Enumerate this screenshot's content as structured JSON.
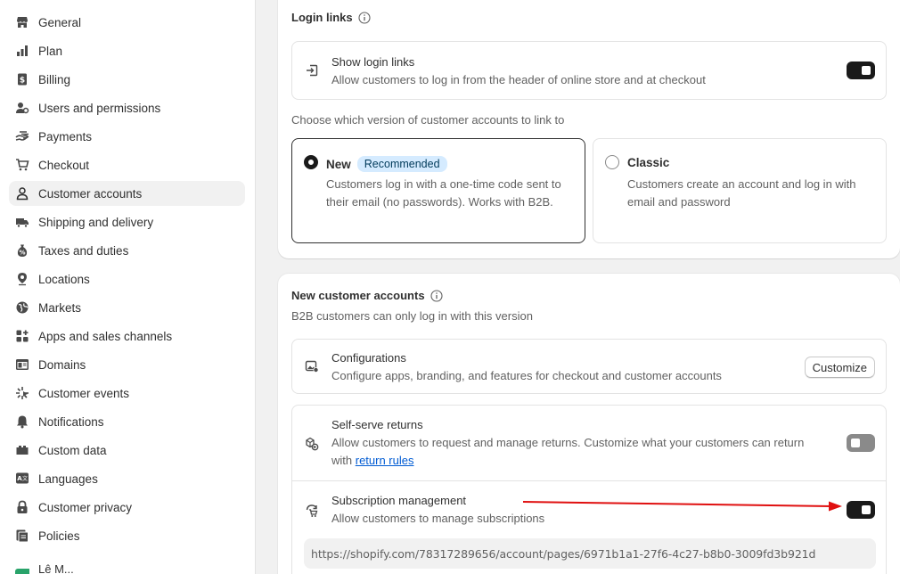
{
  "sidebar": {
    "items": [
      {
        "label": "General",
        "icon": "store-icon"
      },
      {
        "label": "Plan",
        "icon": "plan-icon"
      },
      {
        "label": "Billing",
        "icon": "billing-icon"
      },
      {
        "label": "Users and permissions",
        "icon": "users-icon"
      },
      {
        "label": "Payments",
        "icon": "payments-icon"
      },
      {
        "label": "Checkout",
        "icon": "cart-icon"
      },
      {
        "label": "Customer accounts",
        "icon": "person-icon",
        "active": true
      },
      {
        "label": "Shipping and delivery",
        "icon": "truck-icon"
      },
      {
        "label": "Taxes and duties",
        "icon": "tax-icon"
      },
      {
        "label": "Locations",
        "icon": "location-icon"
      },
      {
        "label": "Markets",
        "icon": "globe-icon"
      },
      {
        "label": "Apps and sales channels",
        "icon": "apps-icon"
      },
      {
        "label": "Domains",
        "icon": "domain-icon"
      },
      {
        "label": "Customer events",
        "icon": "events-icon"
      },
      {
        "label": "Notifications",
        "icon": "bell-icon"
      },
      {
        "label": "Custom data",
        "icon": "custom-data-icon"
      },
      {
        "label": "Languages",
        "icon": "language-icon"
      },
      {
        "label": "Customer privacy",
        "icon": "lock-icon"
      },
      {
        "label": "Policies",
        "icon": "policies-icon"
      }
    ],
    "footer_partial": "Lê M..."
  },
  "login_links": {
    "title": "Login links",
    "show": {
      "title": "Show login links",
      "desc": "Allow customers to log in from the header of online store and at checkout",
      "enabled": true
    },
    "choose_label": "Choose which version of customer accounts to link to",
    "options": {
      "new": {
        "title": "New",
        "badge": "Recommended",
        "desc": "Customers log in with a one-time code sent to their email (no passwords). Works with B2B.",
        "selected": true
      },
      "classic": {
        "title": "Classic",
        "desc": "Customers create an account and log in with email and password",
        "selected": false
      }
    }
  },
  "new_accounts": {
    "title": "New customer accounts",
    "subtitle": "B2B customers can only log in with this version",
    "configurations": {
      "title": "Configurations",
      "desc": "Configure apps, branding, and features for checkout and customer accounts",
      "button": "Customize"
    },
    "self_serve": {
      "title": "Self-serve returns",
      "desc_prefix": "Allow customers to request and manage returns. Customize what your customers can return with ",
      "link": "return rules",
      "enabled": false
    },
    "subscription": {
      "title": "Subscription management",
      "desc": "Allow customers to manage subscriptions",
      "enabled": true,
      "url": "https://shopify.com/78317289656/account/pages/6971b1a1-27f6-4c27-b8b0-3009fd3b921d"
    }
  },
  "colors": {
    "annotation_arrow": "#e01010",
    "toggle_on": "#1a1a1a",
    "toggle_off": "#8a8a8a",
    "badge_bg": "#d5ebff",
    "link": "#005bd3"
  }
}
